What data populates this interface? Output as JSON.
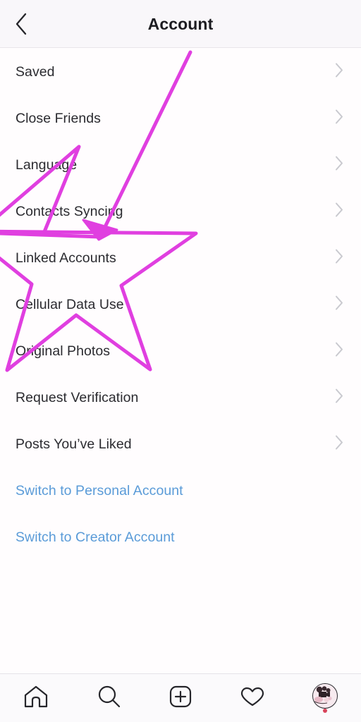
{
  "header": {
    "title": "Account",
    "back_icon": "chevron-left-icon"
  },
  "list": {
    "items": [
      {
        "label": "Saved",
        "chevron": "chevron-right-icon"
      },
      {
        "label": "Close Friends",
        "chevron": "chevron-right-icon"
      },
      {
        "label": "Language",
        "chevron": "chevron-right-icon"
      },
      {
        "label": "Contacts Syncing",
        "chevron": "chevron-right-icon"
      },
      {
        "label": "Linked Accounts",
        "chevron": "chevron-right-icon"
      },
      {
        "label": "Cellular Data Use",
        "chevron": "chevron-right-icon"
      },
      {
        "label": "Original Photos",
        "chevron": "chevron-right-icon"
      },
      {
        "label": "Request Verification",
        "chevron": "chevron-right-icon"
      },
      {
        "label": "Posts You’ve Liked",
        "chevron": "chevron-right-icon"
      }
    ],
    "links": [
      {
        "label": "Switch to Personal Account"
      },
      {
        "label": "Switch to Creator Account"
      }
    ]
  },
  "tabbar": {
    "items": [
      {
        "name": "home-icon"
      },
      {
        "name": "search-icon"
      },
      {
        "name": "add-post-icon"
      },
      {
        "name": "activity-heart-icon"
      },
      {
        "name": "profile-avatar"
      }
    ],
    "badge": "notification-dot"
  },
  "annotation": {
    "shape": "star-outline-with-arrowhead",
    "color": "#e03fe0",
    "stroke_width": 5
  },
  "colors": {
    "header_bg": "#f9f7fa",
    "page_bg": "#fffdfe",
    "text": "#2b2b30",
    "link": "#5a9bd8",
    "chevron": "#c9c9cf",
    "annotation": "#e03fe0",
    "badge": "#d9445c"
  }
}
